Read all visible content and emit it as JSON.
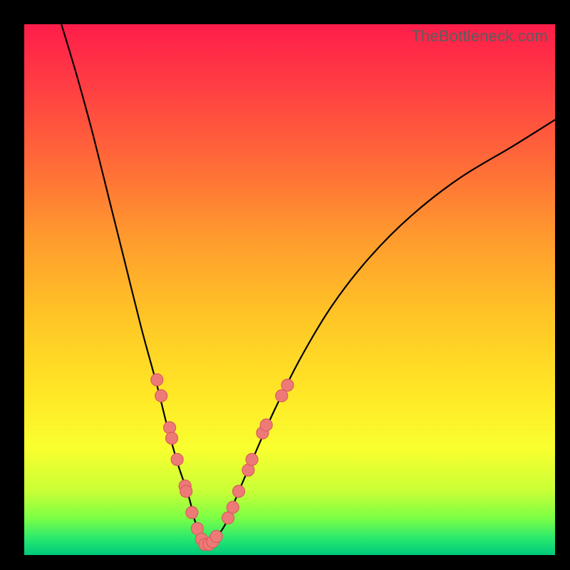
{
  "watermark": "TheBottleneck.com",
  "colors": {
    "frame": "#000000",
    "gradient_top": "#ff1d4a",
    "gradient_bottom": "#00c97a",
    "curve": "#000000",
    "dot_fill": "#ee7a78",
    "dot_stroke": "#d85c5c"
  },
  "chart_data": {
    "type": "line",
    "title": "",
    "xlabel": "",
    "ylabel": "",
    "x_range": [
      0,
      100
    ],
    "y_range": [
      0,
      100
    ],
    "series": [
      {
        "name": "bottleneck-curve",
        "x": [
          7,
          10,
          13,
          16,
          19,
          22,
          25,
          27,
          29,
          31,
          32,
          33,
          34,
          35,
          36,
          38,
          40,
          43,
          47,
          52,
          58,
          65,
          73,
          82,
          92,
          100
        ],
        "y": [
          100,
          90,
          79,
          67,
          55,
          43,
          32,
          24,
          17,
          11,
          7,
          4,
          2,
          2,
          3,
          6,
          11,
          18,
          27,
          37,
          47,
          56,
          64,
          71,
          77,
          82
        ]
      }
    ],
    "scatter_points": {
      "name": "highlighted-points",
      "points": [
        {
          "x": 25.0,
          "y": 33
        },
        {
          "x": 25.8,
          "y": 30
        },
        {
          "x": 27.4,
          "y": 24
        },
        {
          "x": 27.8,
          "y": 22
        },
        {
          "x": 28.8,
          "y": 18
        },
        {
          "x": 30.3,
          "y": 13
        },
        {
          "x": 30.5,
          "y": 12
        },
        {
          "x": 31.6,
          "y": 8
        },
        {
          "x": 32.6,
          "y": 5
        },
        {
          "x": 33.4,
          "y": 3
        },
        {
          "x": 34.0,
          "y": 2
        },
        {
          "x": 34.8,
          "y": 2
        },
        {
          "x": 35.5,
          "y": 2.5
        },
        {
          "x": 36.2,
          "y": 3.5
        },
        {
          "x": 38.4,
          "y": 7
        },
        {
          "x": 39.3,
          "y": 9
        },
        {
          "x": 40.4,
          "y": 12
        },
        {
          "x": 42.2,
          "y": 16
        },
        {
          "x": 42.9,
          "y": 18
        },
        {
          "x": 44.9,
          "y": 23
        },
        {
          "x": 45.6,
          "y": 24.5
        },
        {
          "x": 48.5,
          "y": 30
        },
        {
          "x": 49.6,
          "y": 32
        }
      ]
    }
  }
}
